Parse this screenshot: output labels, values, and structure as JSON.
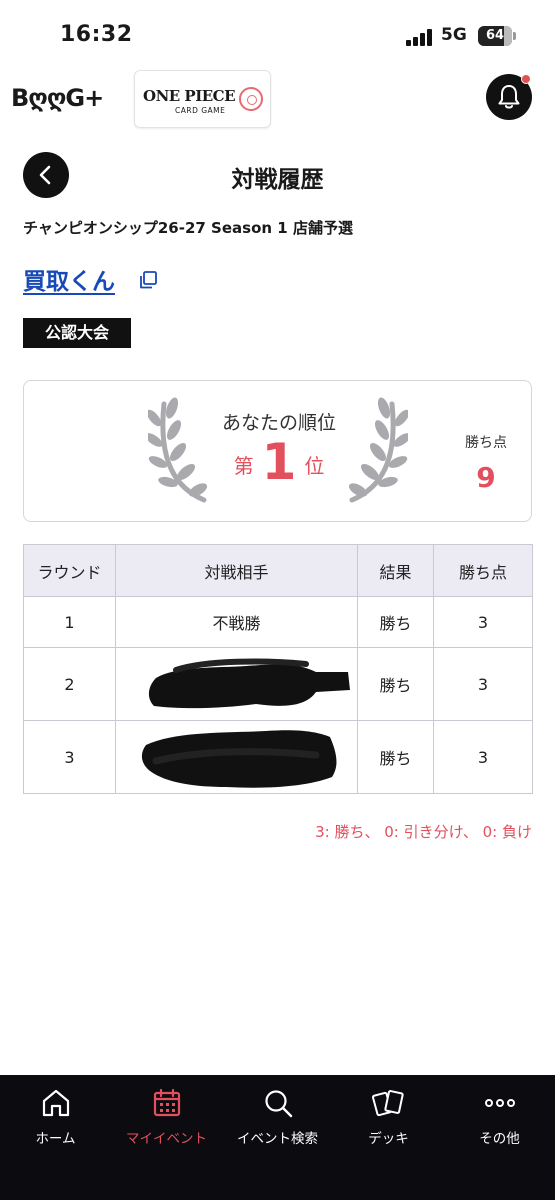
{
  "status_bar": {
    "time": "16:32",
    "network": "5G",
    "battery": "64"
  },
  "header": {
    "brand_logo": "BღღG+",
    "game_logo_title": "ONE PIECE",
    "game_logo_subtitle": "CARD GAME",
    "notification_dot": true
  },
  "page": {
    "title": "対戦履歴",
    "event_name": "チャンピオンシップ26-27 Season 1 店舗予選",
    "shop_name": "買取くん",
    "badge": "公認大会"
  },
  "rank": {
    "label": "あなたの順位",
    "prefix": "第",
    "value": "1",
    "suffix": "位",
    "points_label": "勝ち点",
    "points_value": "9"
  },
  "table": {
    "headers": [
      "ラウンド",
      "対戦相手",
      "結果",
      "勝ち点"
    ],
    "rows": [
      {
        "round": "1",
        "opponent": "不戦勝",
        "result": "勝ち",
        "points": "3"
      },
      {
        "round": "2",
        "opponent": "",
        "result": "勝ち",
        "points": "3"
      },
      {
        "round": "3",
        "opponent": "",
        "result": "勝ち",
        "points": "3"
      }
    ]
  },
  "legend": "3: 勝ち、 0: 引き分け、 0: 負け",
  "bottom_nav": [
    {
      "label": "ホーム",
      "icon": "home-icon",
      "active": false
    },
    {
      "label": "マイイベント",
      "icon": "calendar-icon",
      "active": true
    },
    {
      "label": "イベント検索",
      "icon": "search-icon",
      "active": false
    },
    {
      "label": "デッキ",
      "icon": "cards-icon",
      "active": false
    },
    {
      "label": "その他",
      "icon": "more-icon",
      "active": false
    }
  ],
  "colors": {
    "accent": "#e2505e",
    "link": "#1749b8",
    "dark": "#111111",
    "nav_bg": "#0b0b10"
  }
}
